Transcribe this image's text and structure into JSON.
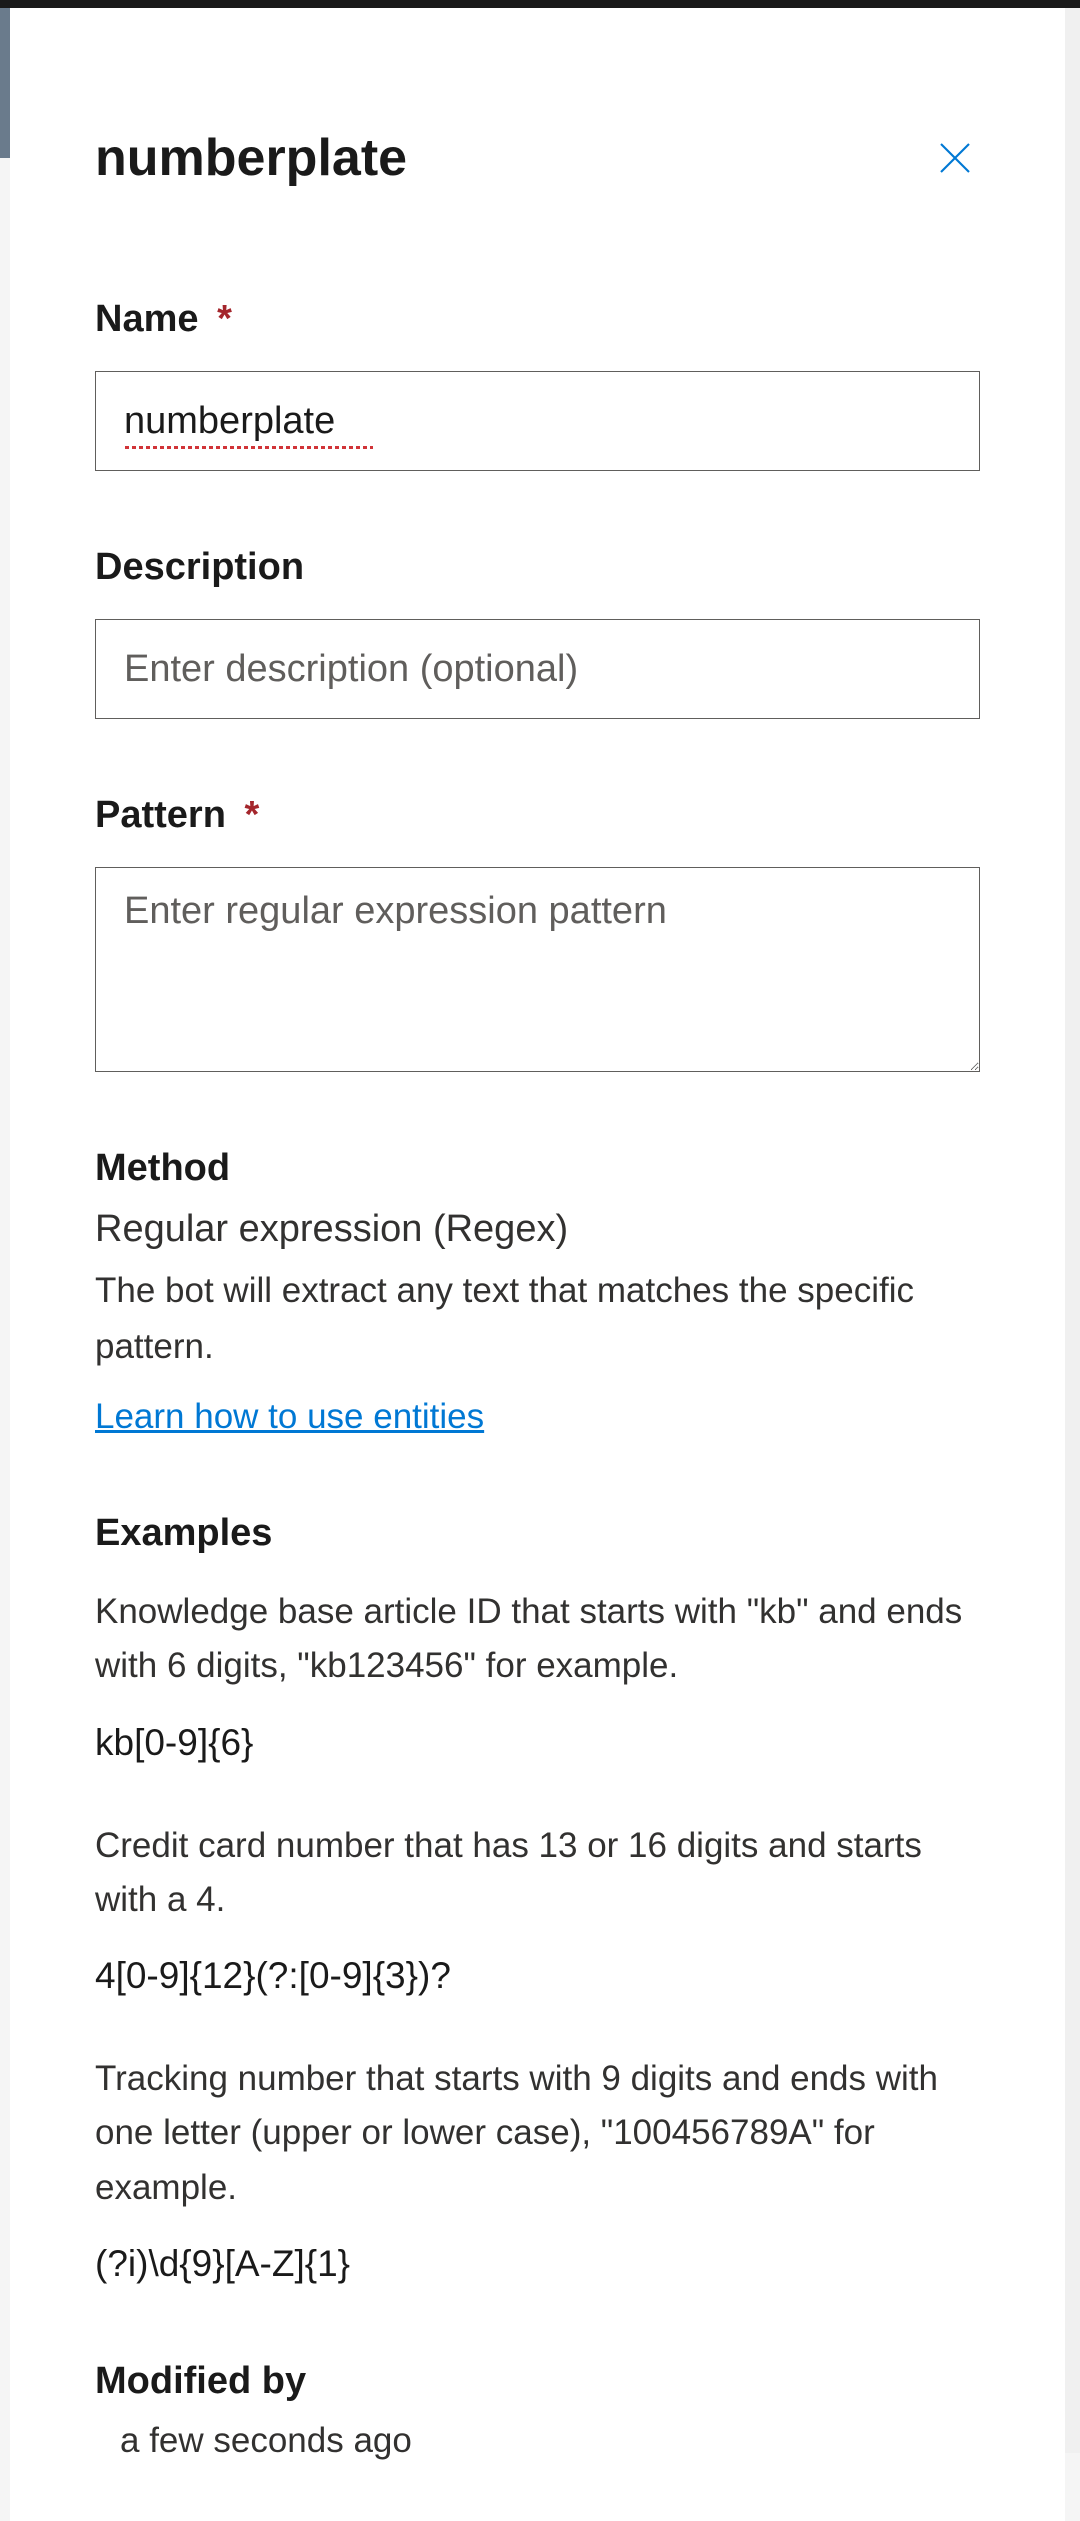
{
  "panel": {
    "title": "numberplate",
    "fields": {
      "name": {
        "label": "Name",
        "required": true,
        "value": "numberplate"
      },
      "description": {
        "label": "Description",
        "required": false,
        "placeholder": "Enter description (optional)",
        "value": ""
      },
      "pattern": {
        "label": "Pattern",
        "required": true,
        "placeholder": "Enter regular expression pattern",
        "value": ""
      }
    },
    "method": {
      "heading": "Method",
      "name": "Regular expression (Regex)",
      "description": "The bot will extract any text that matches the specific pattern.",
      "link_text": "Learn how to use entities"
    },
    "examples": {
      "heading": "Examples",
      "items": [
        {
          "description": "Knowledge base article ID that starts with \"kb\" and ends with 6 digits, \"kb123456\" for example.",
          "pattern": "kb[0-9]{6}"
        },
        {
          "description": "Credit card number that has 13 or 16 digits and starts with a 4.",
          "pattern": "4[0-9]{12}(?:[0-9]{3})?"
        },
        {
          "description": "Tracking number that starts with 9 digits and ends with one letter (upper or lower case), \"100456789A\" for example.",
          "pattern": "(?i)\\d{9}[A-Z]{1}"
        }
      ]
    },
    "modified": {
      "heading": "Modified by",
      "time": "a few seconds ago"
    },
    "required_marker": "*"
  }
}
